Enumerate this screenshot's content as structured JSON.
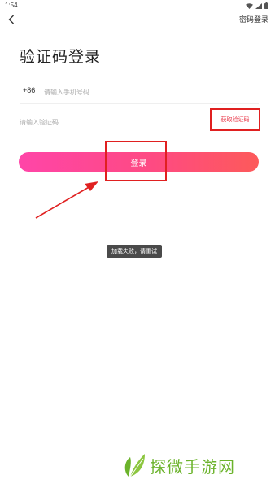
{
  "status_bar": {
    "time": "1:54"
  },
  "header": {
    "back_icon": "chevron-left-icon",
    "password_login": "密码登录"
  },
  "title": "验证码登录",
  "phone": {
    "country_code": "+86",
    "placeholder": "请输入手机号码"
  },
  "code": {
    "placeholder": "请输入验证码",
    "get_code": "获取验证码"
  },
  "login_button": "登录",
  "toast": "加载失败，请重试",
  "watermark": {
    "text": "探微手游网"
  },
  "colors": {
    "accent": "#fe4a83",
    "gradient_start": "#ff45a8",
    "gradient_end": "#fd5a5a",
    "annotation": "#e02020",
    "watermark": "#6bb32b"
  }
}
